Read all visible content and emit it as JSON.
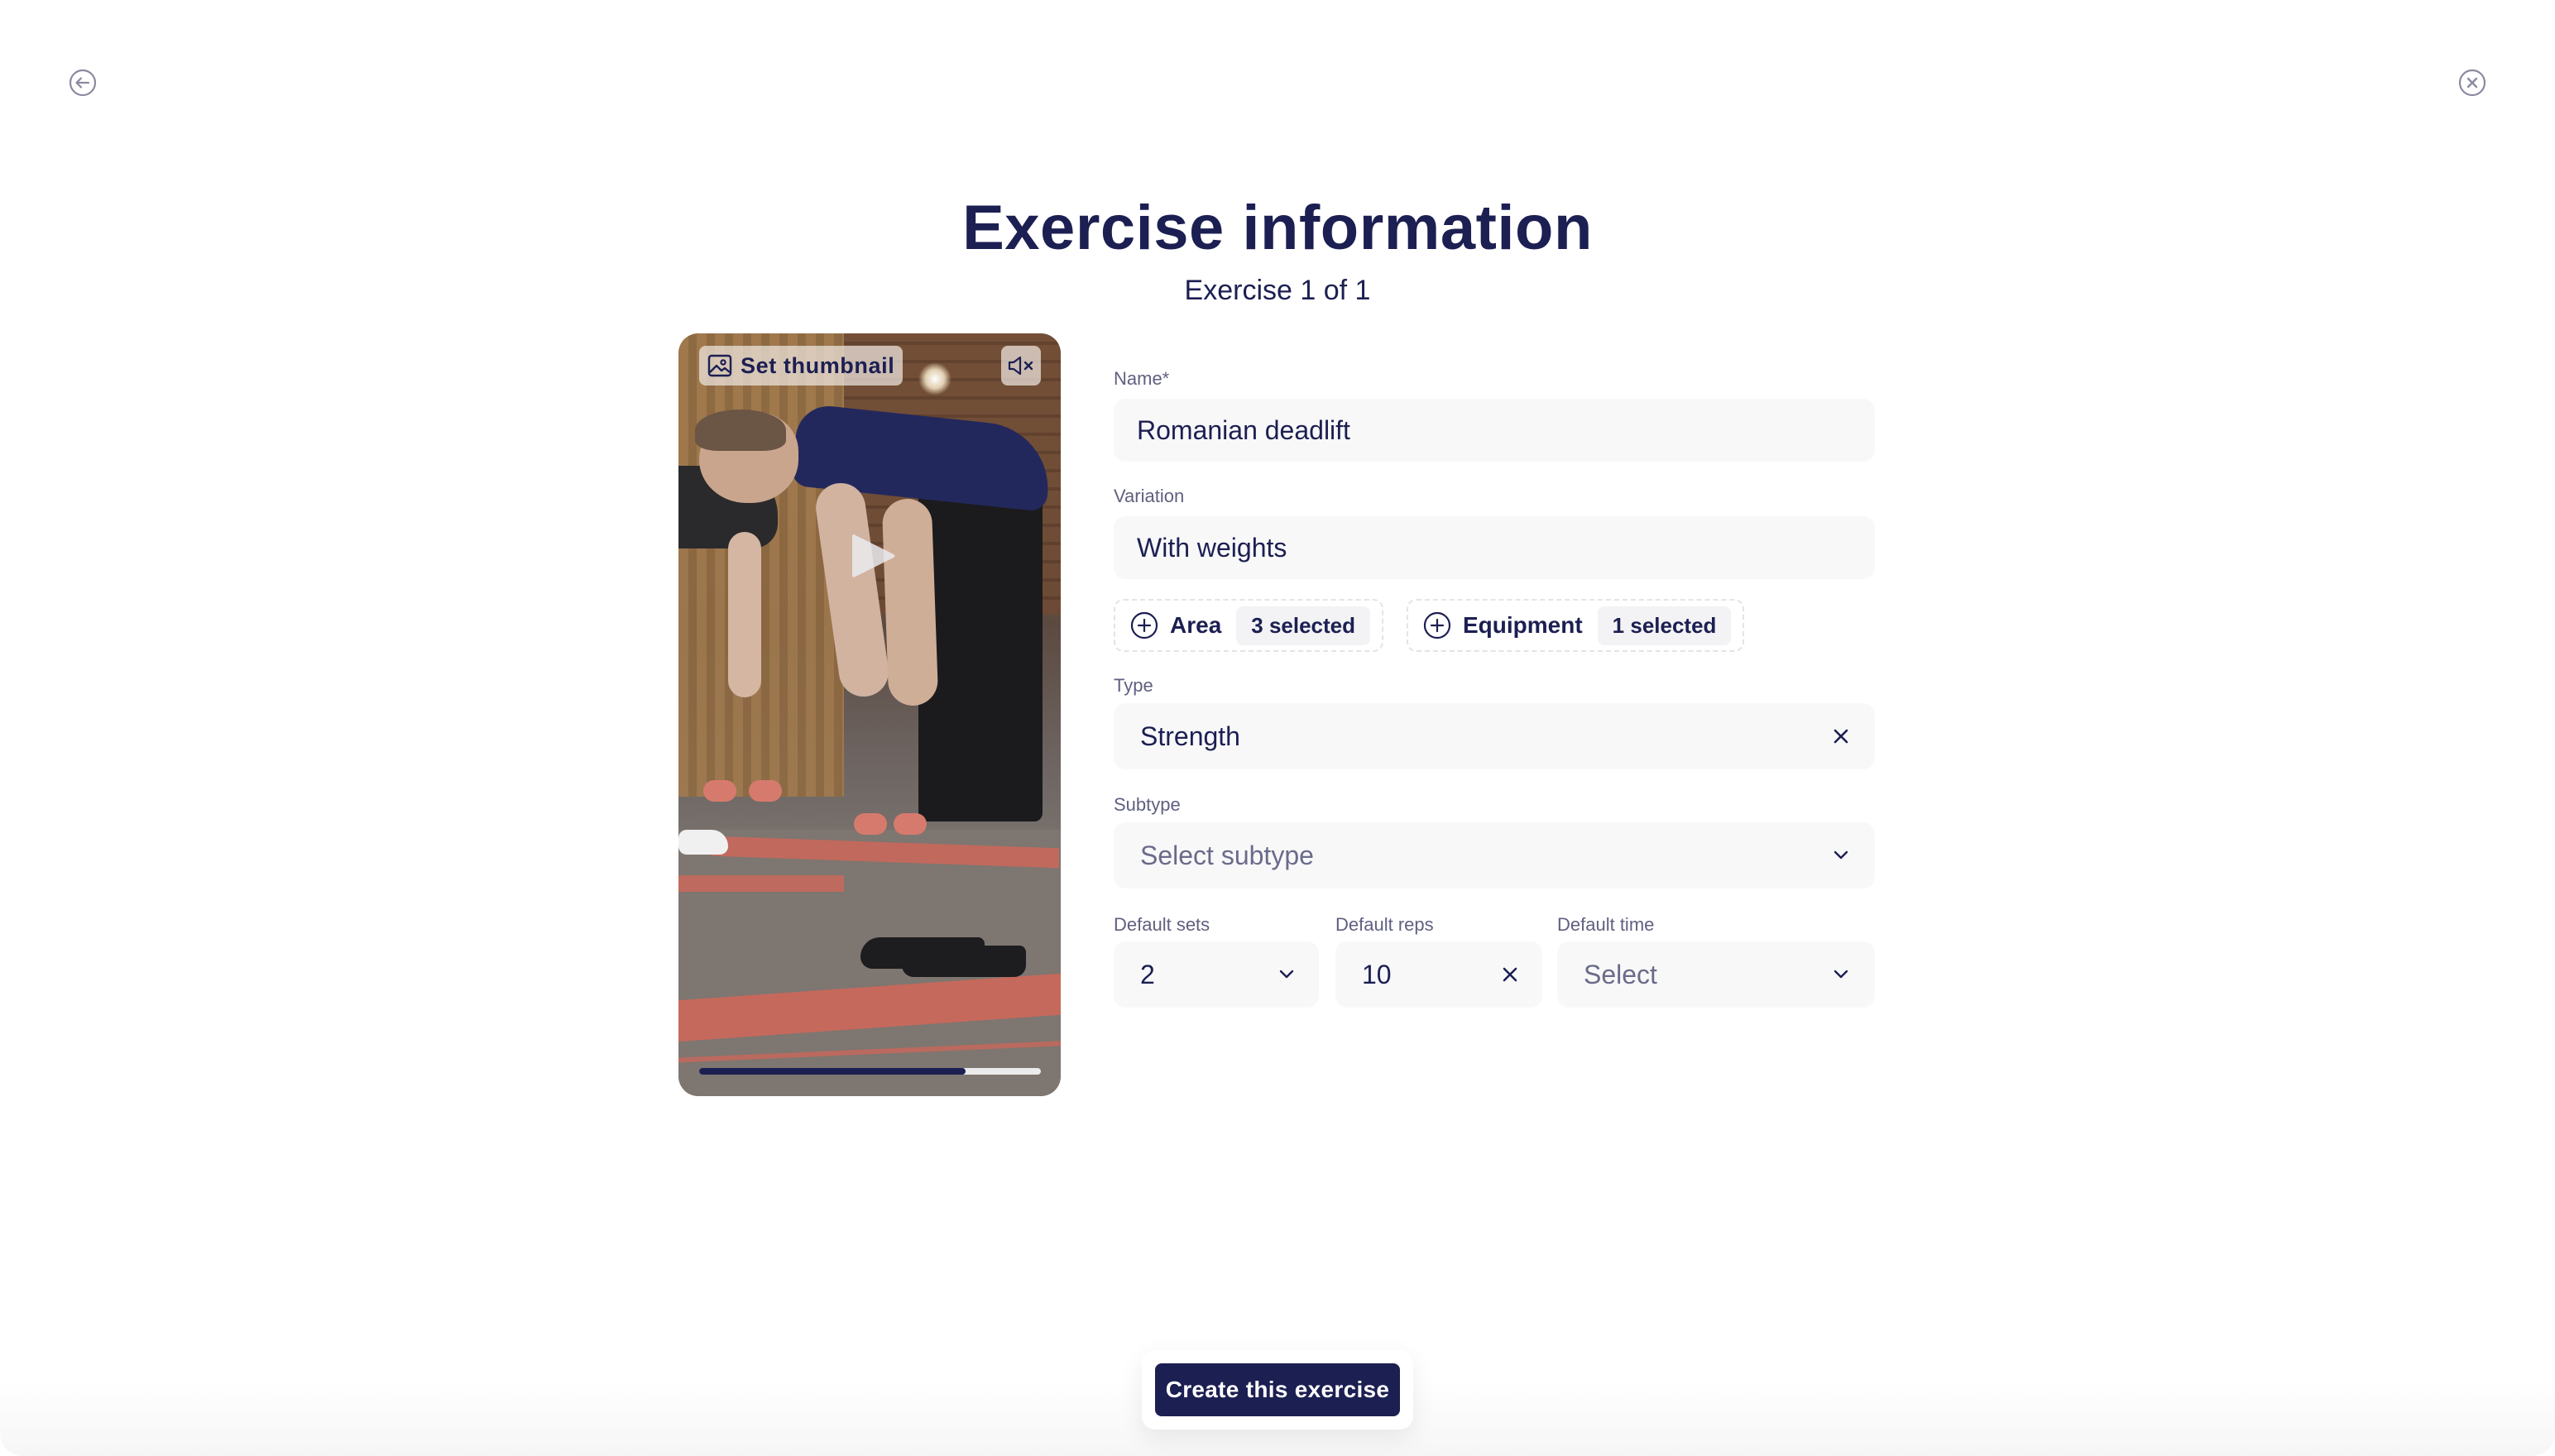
{
  "header": {
    "back_icon": "arrow-left-circle-icon",
    "close_icon": "x-circle-icon",
    "title": "Exercise information",
    "subtitle": "Exercise 1 of 1"
  },
  "video": {
    "set_thumbnail_label": "Set thumbnail",
    "thumbnail_icon": "image-icon",
    "mute_icon": "volume-muted-icon",
    "play_icon": "play-icon",
    "progress_fraction": 0.78
  },
  "form": {
    "name": {
      "label": "Name*",
      "value": "Romanian deadlift"
    },
    "variation": {
      "label": "Variation",
      "value": "With weights"
    },
    "chips": [
      {
        "label": "Area",
        "badge": "3 selected",
        "icon": "plus-circle-icon"
      },
      {
        "label": "Equipment",
        "badge": "1 selected",
        "icon": "plus-circle-icon"
      }
    ],
    "type": {
      "label": "Type",
      "value": "Strength",
      "trailing_icon": "clear-x-icon"
    },
    "subtype": {
      "label": "Subtype",
      "placeholder": "Select subtype",
      "trailing_icon": "chevron-down-icon"
    },
    "default_sets": {
      "label": "Default sets",
      "value": "2",
      "trailing_icon": "chevron-down-icon"
    },
    "default_reps": {
      "label": "Default reps",
      "value": "10",
      "trailing_icon": "clear-x-icon"
    },
    "default_time": {
      "label": "Default time",
      "placeholder": "Select",
      "trailing_icon": "chevron-down-icon"
    }
  },
  "footer": {
    "create_label": "Create this exercise"
  },
  "colors": {
    "primary": "#1c1f52",
    "label": "#5f6080",
    "field_bg": "#f8f8f9",
    "icon_gray": "#8a8aa0"
  }
}
